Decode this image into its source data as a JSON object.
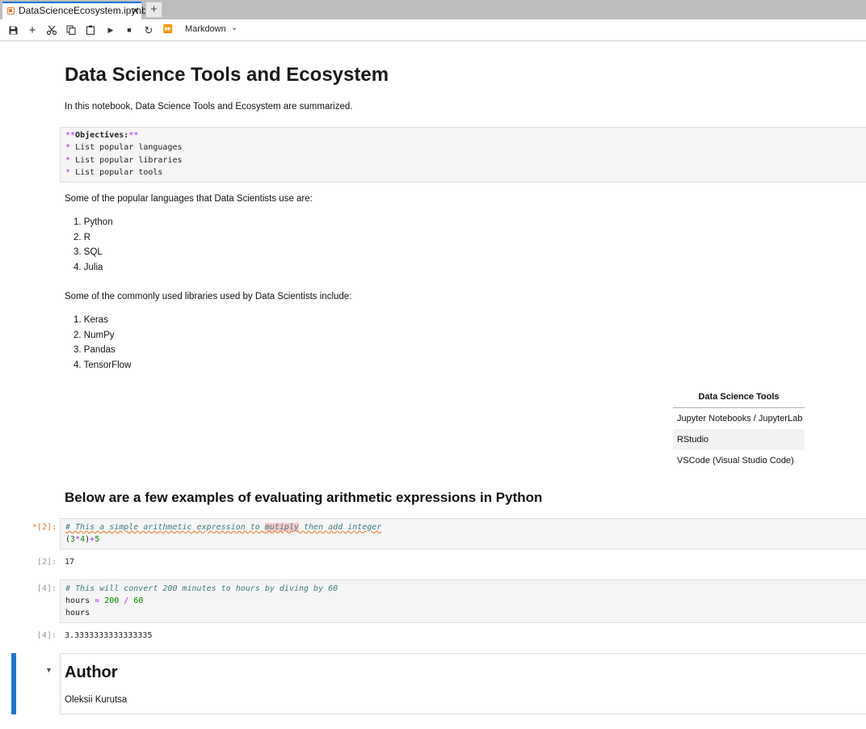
{
  "tab": {
    "title": "DataScienceEcosystem.ipynb",
    "close": "✕",
    "new_tab": "+"
  },
  "toolbar": {
    "cell_type": "Markdown"
  },
  "notebook": {
    "title": "Data Science Tools and Ecosystem",
    "intro": "In this notebook, Data Science Tools and Ecosystem are summarized.",
    "objectives_cell": {
      "line1_open": "**",
      "line1_text": "Objectives:",
      "line1_close": "**",
      "bullet": "*",
      "items": [
        "List popular languages",
        "List popular libraries",
        "List popular tools"
      ]
    },
    "languages_intro": "Some of the popular languages that Data Scientists use are:",
    "languages": [
      "1. Python",
      "2. R",
      "3. SQL",
      "4. Julia"
    ],
    "libraries_intro": "Some of the commonly used libraries used by Data Scientists include:",
    "libraries": [
      "1. Keras",
      "2. NumPy",
      "3. Pandas",
      "4. TensorFlow"
    ],
    "tools_table": {
      "header": "Data Science Tools",
      "rows": [
        "Jupyter Notebooks / JupyterLab",
        "RStudio",
        "VSCode (Visual Studio Code)"
      ]
    },
    "examples_heading": "Below are a few examples of evaluating arithmetic expressions in Python",
    "cell1": {
      "prompt": "*[2]:",
      "comment_a": "# This a simple arithmetic expression to ",
      "comment_hl": "mutiply",
      "comment_b": " then add integer",
      "p1": "(",
      "n1": "3",
      "op1": "*",
      "n2": "4",
      "p2": ")",
      "op2": "+",
      "n3": "5"
    },
    "out1": {
      "prompt": "[2]:",
      "value": "17"
    },
    "cell2": {
      "prompt": "[4]:",
      "comment": "# This will convert 200 minutes to hours by diving by 60",
      "var": "hours",
      "eq": " = ",
      "a": "200",
      "div": " / ",
      "b": "60",
      "line3": "hours"
    },
    "out2": {
      "prompt": "[4]:",
      "value": "3.3333333333333335"
    },
    "author_heading": "Author",
    "author_name": "Oleksii Kurutsa"
  },
  "icons": [
    "save-icon",
    "add-cell-icon",
    "cut-icon",
    "copy-icon",
    "paste-icon",
    "run-icon",
    "stop-icon",
    "restart-icon",
    "run-all-icon",
    "chevron-down-icon",
    "notebook-icon",
    "collapse-caret-icon"
  ],
  "colors": {
    "accent": "#1976d2",
    "tab_bar": "#bdbdbd",
    "cell_bg": "#f5f5f5",
    "comment": "#3d7b7b",
    "operator": "#aa22ff",
    "number": "#008800",
    "dirty_prompt": "#e07b3a"
  }
}
